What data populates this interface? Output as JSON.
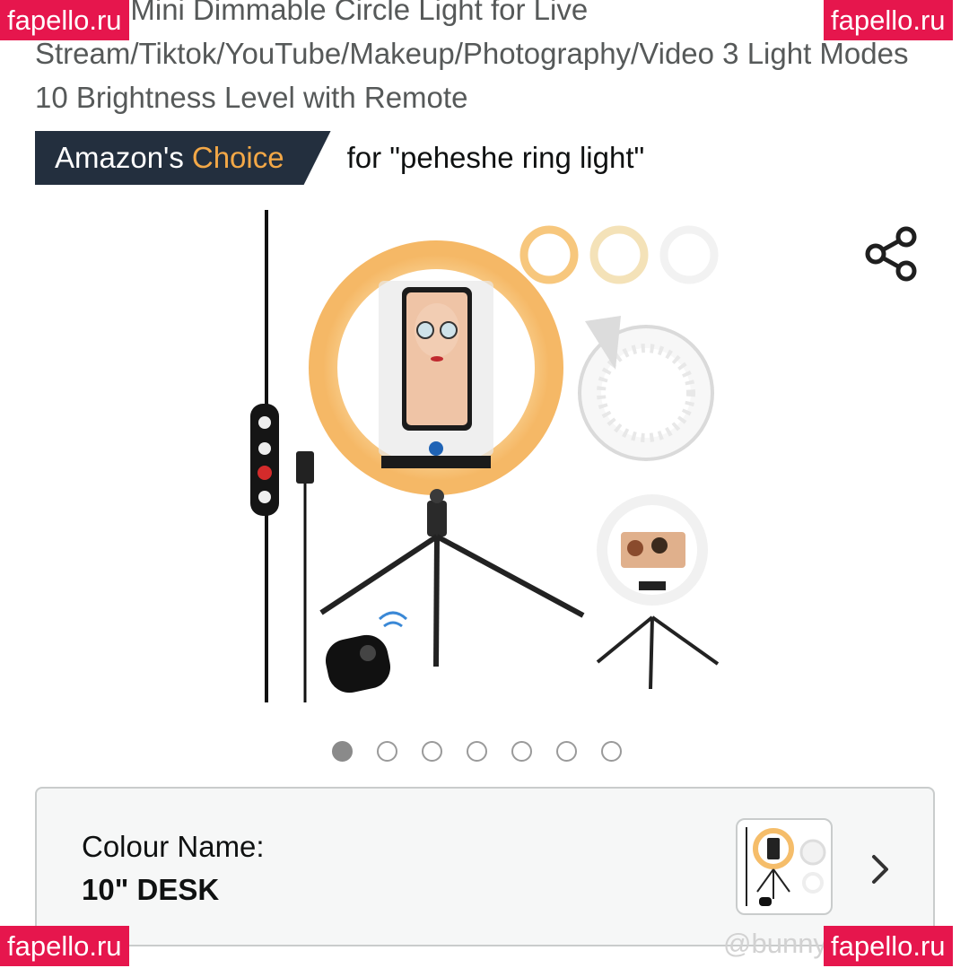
{
  "product": {
    "title": "Holder Mini Dimmable Circle Light for Live Stream/Tiktok/YouTube/Makeup/Photography/Video 3 Light Modes 10 Brightness Level with Remote"
  },
  "badge": {
    "label_prefix": "Amazon's",
    "label_accent": "Choice",
    "for_text": "for \"peheshe ring light\""
  },
  "gallery": {
    "total_images": 7,
    "active_index": 1
  },
  "variant": {
    "label": "Colour Name:",
    "value": "10\" DESK"
  },
  "watermarks": {
    "top_left": "fapello.ru",
    "top_right": "fapello.ru",
    "bottom_left": "fapello.ru",
    "bottom_right": "fapello.ru",
    "credit": "@bunny"
  },
  "icons": {
    "share": "share-icon",
    "chevron": "chevron-right-icon"
  },
  "colors": {
    "badge_bg": "#232f3e",
    "badge_accent": "#f3a847",
    "watermark": "#e6164d",
    "title_text": "#565959"
  }
}
